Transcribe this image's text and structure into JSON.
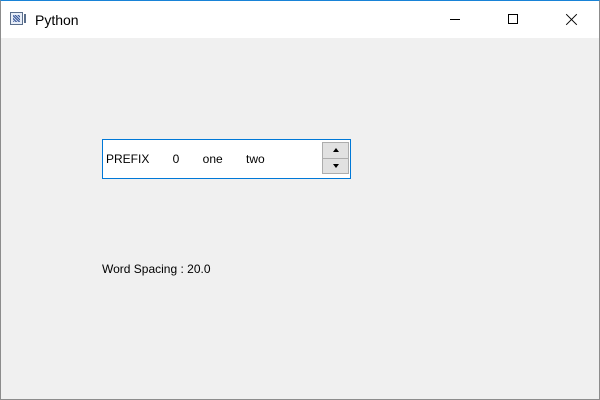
{
  "window": {
    "title": "Python",
    "icon": "python-app-icon",
    "controls": [
      "minimize-icon",
      "maximize-icon",
      "close-icon"
    ]
  },
  "spinbox": {
    "value_text": "PREFIX 0 one two",
    "word_spacing": 20.0,
    "up_icon": "arrow-up-icon",
    "down_icon": "arrow-down-icon"
  },
  "label": {
    "text": "Word Spacing : 20.0"
  },
  "colors": {
    "window_background": "#f0f0f0",
    "titlebar_background": "#ffffff",
    "focus_border": "#0078d7"
  }
}
